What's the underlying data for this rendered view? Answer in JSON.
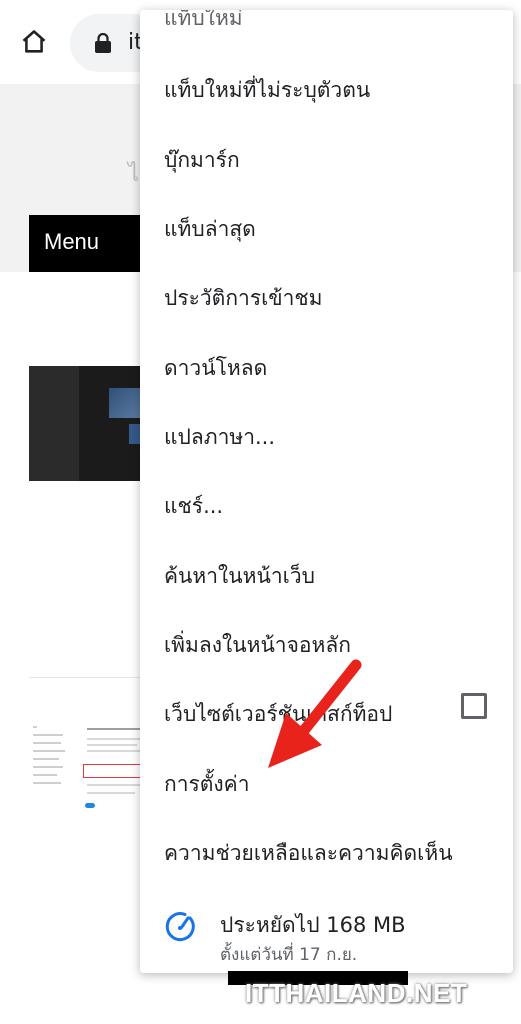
{
  "browser": {
    "url_partial": "it",
    "icons": {
      "home": "home-icon",
      "lock": "lock-icon"
    }
  },
  "page": {
    "menu_label": "Menu",
    "faint_char": "ไ"
  },
  "overflow_menu": {
    "top_cut_label": "แท็บใหม่",
    "items": [
      {
        "label": "แท็บใหม่ที่ไม่ระบุตัวตน"
      },
      {
        "label": "บุ๊กมาร์ก"
      },
      {
        "label": "แท็บล่าสุด"
      },
      {
        "label": "ประวัติการเข้าชม"
      },
      {
        "label": "ดาวน์โหลด"
      },
      {
        "label": "แปลภาษา..."
      },
      {
        "label": "แชร์..."
      },
      {
        "label": "ค้นหาในหน้าเว็บ"
      },
      {
        "label": "เพิ่มลงในหน้าจอหลัก"
      },
      {
        "label": "เว็บไซต์เวอร์ชันเดสก์ท็อป",
        "checked": false
      },
      {
        "label": "การตั้งค่า"
      },
      {
        "label": "ความช่วยเหลือและความคิดเห็น"
      }
    ],
    "data_saver": {
      "title": "ประหยัดไป 168 MB",
      "subtitle": "ตั้งแต่วันที่ 17 ก.ย.",
      "icon": "speedometer-icon",
      "accent": "#1a73e8"
    }
  },
  "annotation": {
    "arrow_color": "#e8231b",
    "points_to": "การตั้งค่า"
  },
  "watermark": "ITTHAILAND.NET"
}
